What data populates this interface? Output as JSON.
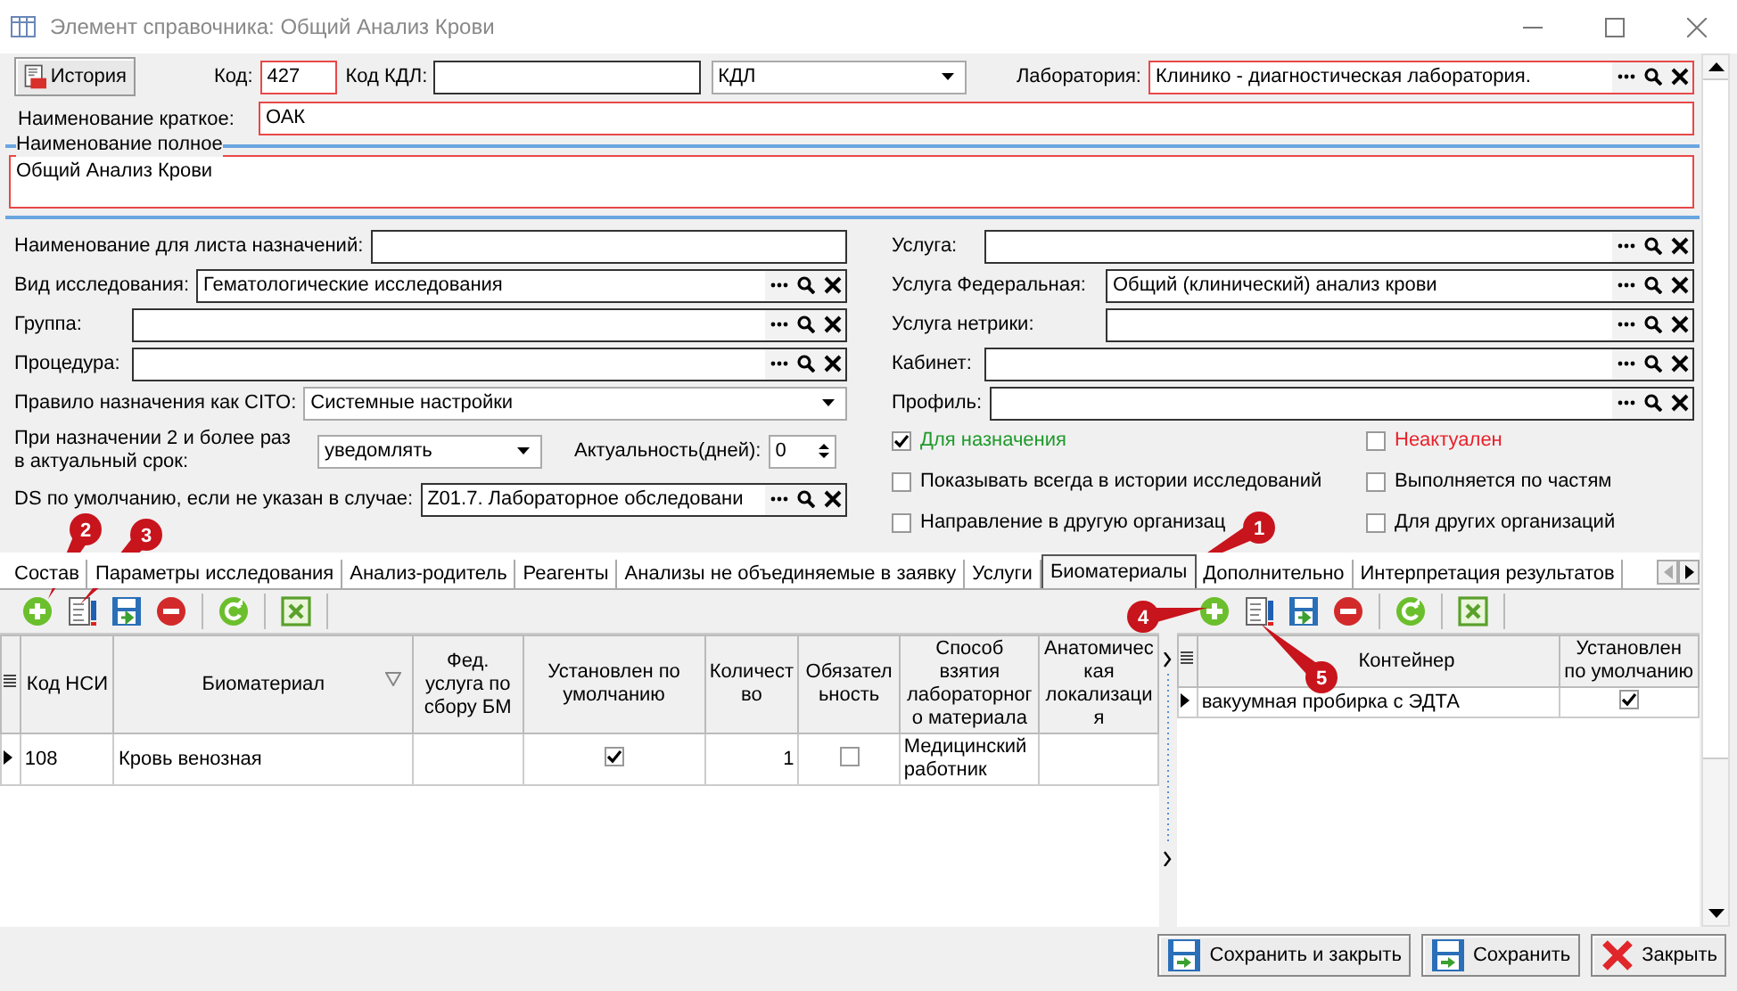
{
  "window": {
    "title": "Элемент справочника: Общий Анализ Крови"
  },
  "history_button": {
    "label": "История"
  },
  "code": {
    "label": "Код:",
    "value": "427",
    "required": true
  },
  "kdl_code": {
    "label": "Код КДЛ:",
    "required": false
  },
  "kdl_type": {
    "value": "КДЛ"
  },
  "laboratory": {
    "label": "Лаборатория:",
    "value": "Клинико - диагностическая лаборатория.",
    "required": true
  },
  "short_name": {
    "label": "Наименование краткое:",
    "value": "ОАК",
    "required": true
  },
  "full_name": {
    "title": "Наименование полное",
    "value": "Общий Анализ Крови",
    "required": true
  },
  "left_fields": [
    {
      "kind": "text",
      "label": "Наименование для листа назначений:"
    },
    {
      "kind": "lookup",
      "label": "Вид исследования:",
      "value": "Гематологические исследования"
    },
    {
      "kind": "lookup",
      "label": "Группа:"
    },
    {
      "kind": "lookup",
      "label": "Процедура:"
    },
    {
      "kind": "dropdown",
      "label": "Правило назначения как CITO:",
      "value": "Системные настройки"
    },
    {
      "kind": "dropdown_spin",
      "label": "При назначении 2 и более раз в актуальный срок:",
      "value": "уведомлять",
      "spin_label": "Актуальность(дней):",
      "spin_value": "0"
    },
    {
      "kind": "lookup",
      "label": "DS по умолчанию, если не указан в случае:",
      "value": "Z01.7. Лабораторное обследовани"
    }
  ],
  "right_fields": [
    {
      "kind": "lookup",
      "label": "Услуга:"
    },
    {
      "kind": "lookup",
      "label": "Услуга Федеральная:",
      "value": "Общий (клинический) анализ крови"
    },
    {
      "kind": "lookup",
      "label": "Услуга нетрики:"
    },
    {
      "kind": "lookup",
      "label": "Кабинет:"
    },
    {
      "kind": "lookup",
      "label": "Профиль:"
    }
  ],
  "checkboxes": [
    {
      "label": "Для назначения",
      "checked": true,
      "color": "#1e9a2a"
    },
    {
      "label": "Неактуален",
      "checked": false,
      "color": "#e8202a"
    },
    {
      "label": "Показывать всегда в истории исследований",
      "checked": false,
      "color": "#000000"
    },
    {
      "label": "Выполняется по частям",
      "checked": false,
      "color": "#000000"
    },
    {
      "label": "Направление в другую организац",
      "checked": false,
      "color": "#000000"
    },
    {
      "label": "Для других организаций",
      "checked": false,
      "color": "#000000"
    }
  ],
  "tabs": [
    {
      "label": "Состав",
      "selected": false
    },
    {
      "label": "Параметры исследования",
      "selected": false
    },
    {
      "label": "Анализ-родитель",
      "selected": false
    },
    {
      "label": "Реагенты",
      "selected": false
    },
    {
      "label": "Анализы не объединяемые в заявку",
      "selected": false
    },
    {
      "label": "Услуги",
      "selected": false
    },
    {
      "label": "Биоматериалы",
      "selected": true
    },
    {
      "label": "Дополнительно",
      "selected": false
    },
    {
      "label": "Интерпретация результатов",
      "selected": false
    }
  ],
  "left_grid": {
    "columns": [
      "Код НСИ",
      "Биоматериал",
      "Фед. услуга по сбору БМ",
      "Установлен по умолчанию",
      "Количество",
      "Обязательность",
      "Способ взятия лабораторного материала",
      "Анатомическая локализация"
    ],
    "rows": [
      {
        "current": true,
        "cells": [
          {
            "kind": "text",
            "text": "108"
          },
          {
            "kind": "text",
            "text": "Кровь венозная"
          },
          {
            "kind": "empty"
          },
          {
            "kind": "check",
            "checked": true
          },
          {
            "kind": "number",
            "text": "1"
          },
          {
            "kind": "check",
            "checked": false
          },
          {
            "kind": "text",
            "text": "Медицинский работник"
          },
          {
            "kind": "empty"
          }
        ]
      }
    ]
  },
  "right_grid": {
    "columns": [
      "Контейнер",
      "Установлен по умолчанию"
    ],
    "rows": [
      {
        "current": true,
        "cells": [
          {
            "kind": "text",
            "text": "вакуумная пробирка с ЭДТА"
          },
          {
            "kind": "check",
            "checked": true
          }
        ]
      }
    ]
  },
  "bottom_buttons": [
    {
      "kind": "save_close",
      "label": "Сохранить и закрыть"
    },
    {
      "kind": "save",
      "label": "Сохранить"
    },
    {
      "kind": "close",
      "label": "Закрыть"
    }
  ],
  "callouts": [
    {
      "number": "2"
    },
    {
      "number": "3"
    },
    {
      "number": "1"
    },
    {
      "number": "4"
    },
    {
      "number": "5"
    }
  ]
}
